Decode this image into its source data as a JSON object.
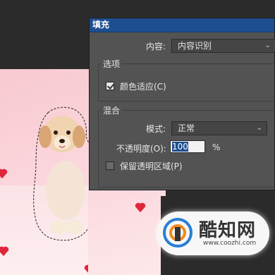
{
  "dialog": {
    "title": "填充",
    "content_label": "内容:",
    "content_value": "内容识别",
    "options_group": "选项",
    "color_adapt_label": "颜色适应(C)",
    "color_adapt_checked": true,
    "blend_group": "混合",
    "mode_label": "模式:",
    "mode_value": "正常",
    "opacity_label": "不透明度(O):",
    "opacity_value": "100",
    "opacity_unit": "%",
    "preserve_label": "保留透明区域(P)",
    "preserve_checked": false
  },
  "watermark": {
    "brand": "酷知网",
    "url": "www.coozhi.com"
  },
  "colors": {
    "titlebar": "#1d4e8f",
    "dialog_bg": "#535353",
    "heart": "#e0263a"
  }
}
